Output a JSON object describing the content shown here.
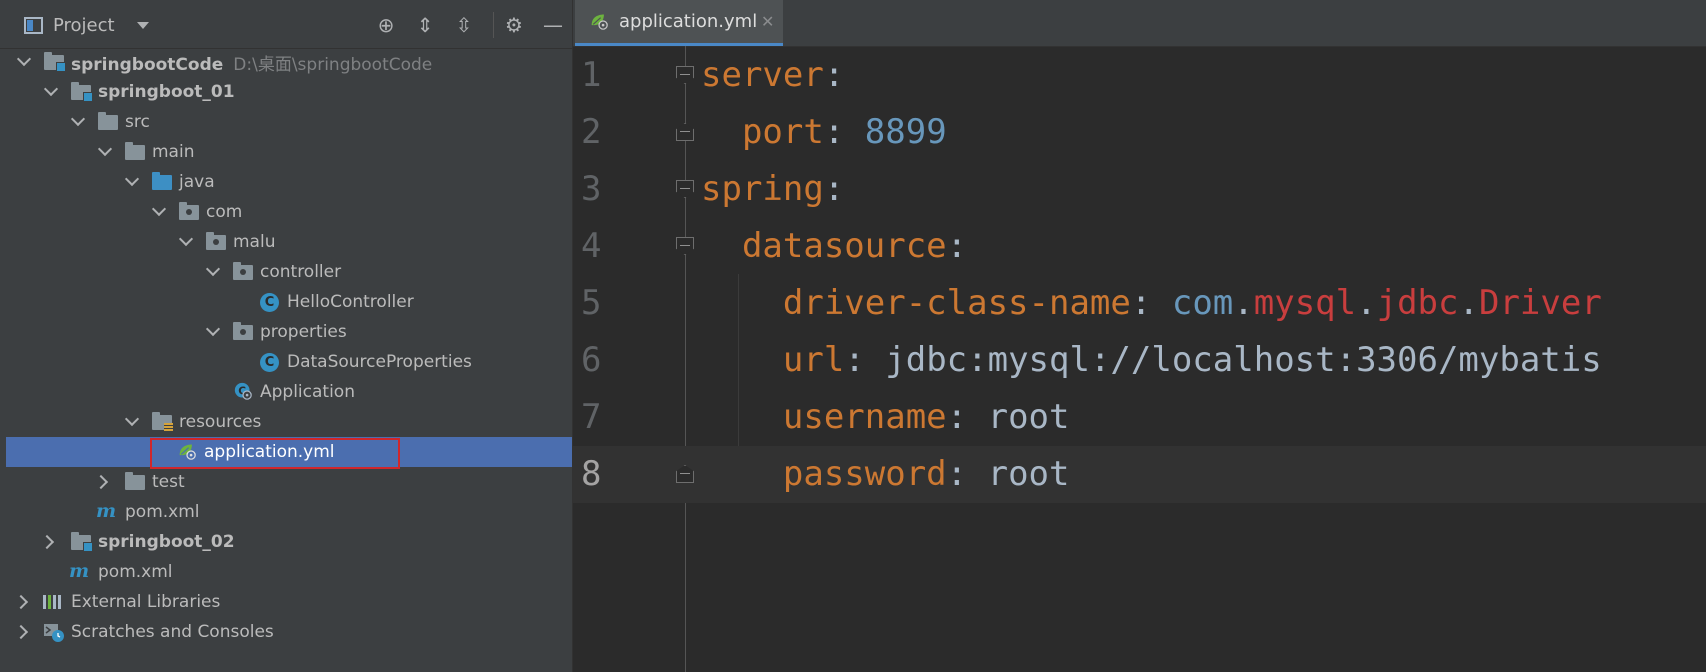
{
  "project_panel": {
    "title": "Project",
    "tools": {
      "locate": "⊕",
      "expand_all": "⇕",
      "collapse_all": "⇳",
      "settings": "⚙",
      "hide": "—"
    },
    "tree": [
      {
        "label": "springbootCode",
        "path": "D:\\桌面\\springbootCode"
      },
      {
        "label": "springboot_01"
      },
      {
        "label": "src"
      },
      {
        "label": "main"
      },
      {
        "label": "java"
      },
      {
        "label": "com"
      },
      {
        "label": "malu"
      },
      {
        "label": "controller"
      },
      {
        "label": "HelloController"
      },
      {
        "label": "properties"
      },
      {
        "label": "DataSourceProperties"
      },
      {
        "label": "Application"
      },
      {
        "label": "resources"
      },
      {
        "label": "application.yml"
      },
      {
        "label": "test"
      },
      {
        "label": "pom.xml"
      },
      {
        "label": "springboot_02"
      },
      {
        "label": "pom.xml"
      },
      {
        "label": "External Libraries"
      },
      {
        "label": "Scratches and Consoles"
      }
    ],
    "class_icon_letter": "C",
    "maven_icon_letter": "m"
  },
  "editor": {
    "tab": {
      "label": "application.yml",
      "close": "✕"
    },
    "line_numbers": [
      "1",
      "2",
      "3",
      "4",
      "5",
      "6",
      "7",
      "8"
    ],
    "lines": {
      "l1_key": "server",
      "l1_colon": ":",
      "l2_indent": "  ",
      "l2_key": "port",
      "l2_colon": ": ",
      "l2_val": "8899",
      "l3_key": "spring",
      "l3_colon": ":",
      "l4_indent": "  ",
      "l4_key": "datasource",
      "l4_colon": ":",
      "l5_indent": "    ",
      "l5_key": "driver-class-name",
      "l5_colon": ": ",
      "l5_v1": "com",
      "l5_d1": ".",
      "l5_v2": "mysql",
      "l5_d2": ".",
      "l5_v3": "jdbc",
      "l5_d3": ".",
      "l5_v4": "Driver",
      "l6_indent": "    ",
      "l6_key": "url",
      "l6_colon": ": ",
      "l6_val": "jdbc:mysql://localhost:3306/mybatis",
      "l7_indent": "    ",
      "l7_key": "username",
      "l7_colon": ": ",
      "l7_val": "root",
      "l8_indent": "    ",
      "l8_key": "password",
      "l8_colon": ": ",
      "l8_val": "root"
    }
  }
}
